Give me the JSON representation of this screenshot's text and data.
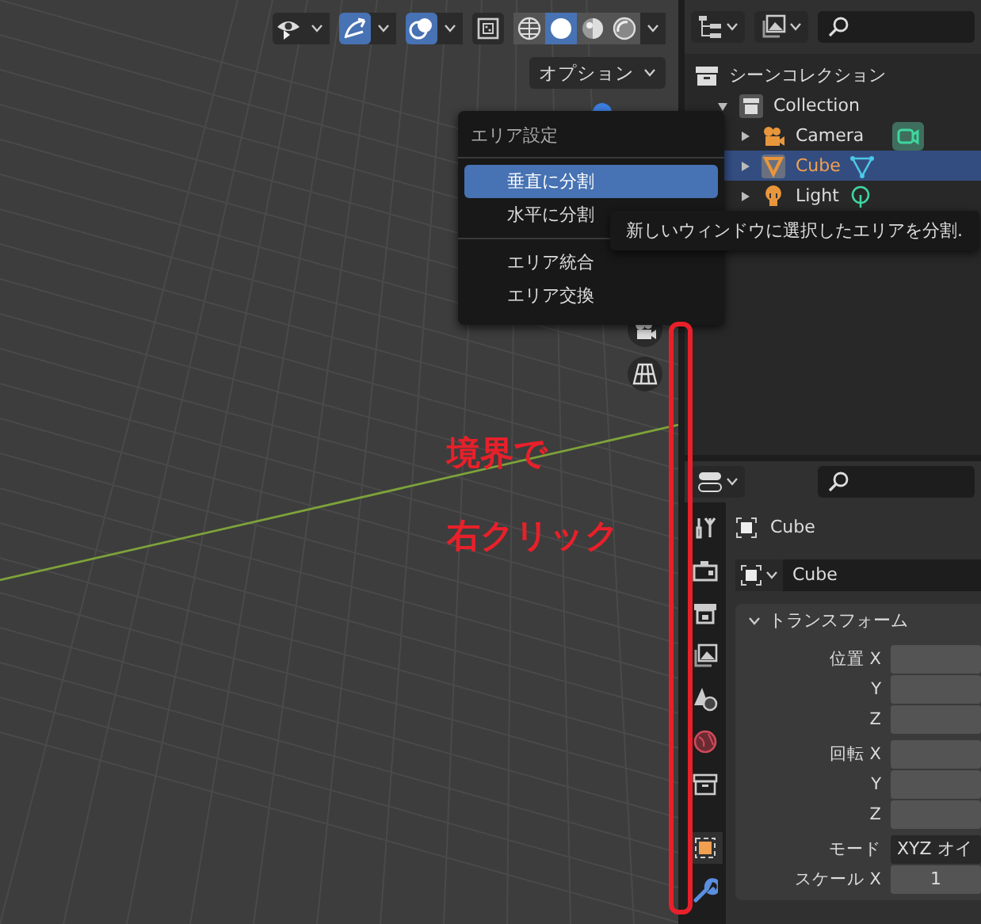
{
  "viewport": {
    "header_toggles": [
      {
        "kind": "visibility",
        "on": false
      },
      {
        "kind": "gizmo",
        "on": true
      },
      {
        "kind": "overlay",
        "on": true
      },
      {
        "kind": "xray",
        "on": false
      }
    ],
    "shading_modes": [
      {
        "kind": "wireframe",
        "selected": false
      },
      {
        "kind": "solid",
        "selected": true
      },
      {
        "kind": "material",
        "selected": false
      },
      {
        "kind": "rendered",
        "selected": false
      }
    ],
    "options_button": "オプション",
    "annotation": [
      "境界で",
      "右クリック"
    ]
  },
  "context_menu": {
    "title": "エリア設定",
    "sections": [
      [
        {
          "label": "垂直に分割",
          "selected": true
        },
        {
          "label": "水平に分割",
          "selected": false
        }
      ],
      [
        {
          "label": "エリア統合",
          "selected": false
        },
        {
          "label": "エリア交換",
          "selected": false
        }
      ]
    ]
  },
  "tooltip": "新しいウィンドウに選択したエリアを分割.",
  "outliner": {
    "tree": [
      {
        "label": "シーンコレクション",
        "kind": "scene",
        "children": [
          {
            "label": "Collection",
            "kind": "collection",
            "expanded": true,
            "children": [
              {
                "label": "Camera",
                "kind": "camera",
                "expanded": false,
                "selected": false
              },
              {
                "label": "Cube",
                "kind": "mesh",
                "expanded": false,
                "selected": true
              },
              {
                "label": "Light",
                "kind": "light",
                "expanded": false,
                "selected": false
              }
            ]
          }
        ]
      }
    ]
  },
  "properties": {
    "tabs": [
      {
        "kind": "tool",
        "selected": false
      },
      {
        "kind": "render",
        "selected": false
      },
      {
        "kind": "output",
        "selected": false
      },
      {
        "kind": "view_layer",
        "selected": false
      },
      {
        "kind": "scene",
        "selected": false
      },
      {
        "kind": "world",
        "selected": false
      },
      {
        "kind": "collection",
        "selected": false
      },
      {
        "kind": "object",
        "selected": true
      },
      {
        "kind": "modifier",
        "selected": false
      }
    ],
    "object_name": "Cube",
    "datablock": "Cube",
    "panel": {
      "title": "トランスフォーム",
      "expanded": true,
      "groups": [
        [
          {
            "label": "位置 X",
            "kind": "number"
          },
          {
            "label": "Y",
            "kind": "number"
          },
          {
            "label": "Z",
            "kind": "number"
          }
        ],
        [
          {
            "label": "回転 X",
            "kind": "number"
          },
          {
            "label": "Y",
            "kind": "number"
          },
          {
            "label": "Z",
            "kind": "number"
          }
        ],
        [
          {
            "label": "モード",
            "kind": "dropdown",
            "value": "XYZ オイ"
          },
          {
            "label": "スケール X",
            "kind": "number",
            "value": "1"
          }
        ]
      ]
    }
  }
}
